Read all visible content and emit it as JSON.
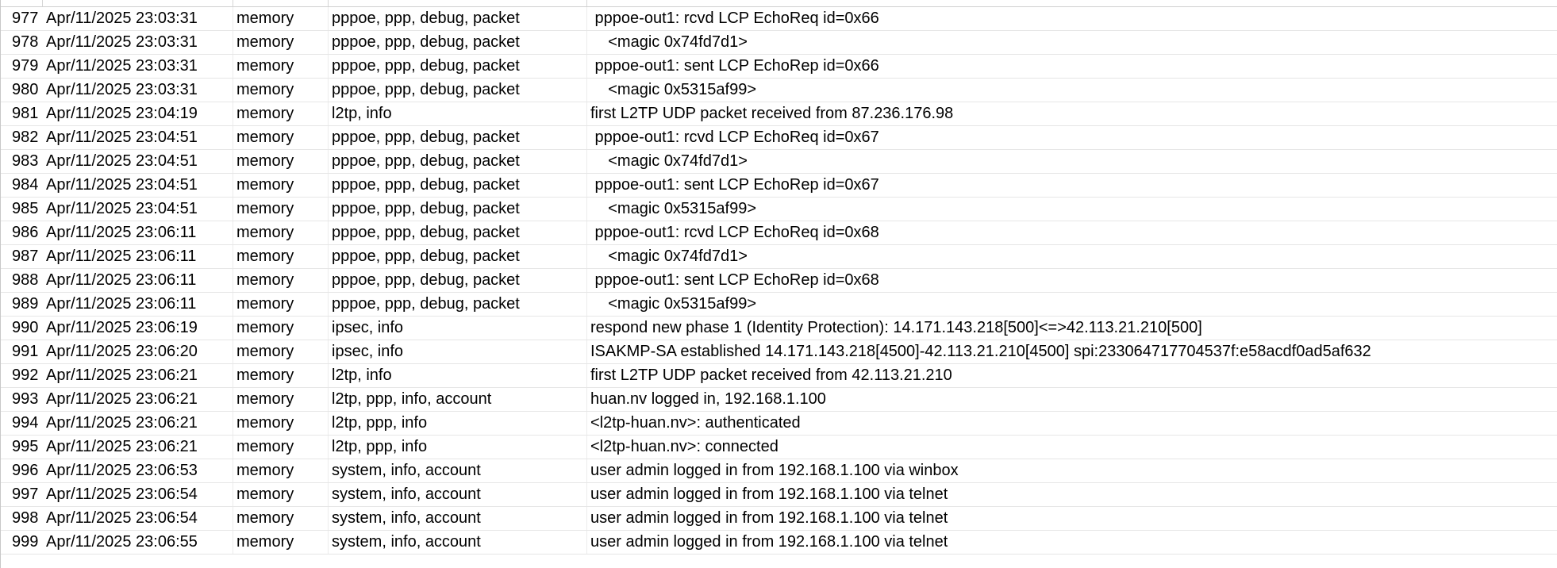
{
  "log_rows": [
    {
      "id": "977",
      "time": "Apr/11/2025 23:03:31",
      "buffer": "memory",
      "topics": "pppoe, ppp, debug, packet",
      "message": " pppoe-out1: rcvd LCP EchoReq id=0x66"
    },
    {
      "id": "978",
      "time": "Apr/11/2025 23:03:31",
      "buffer": "memory",
      "topics": "pppoe, ppp, debug, packet",
      "message": "    <magic 0x74fd7d1>"
    },
    {
      "id": "979",
      "time": "Apr/11/2025 23:03:31",
      "buffer": "memory",
      "topics": "pppoe, ppp, debug, packet",
      "message": " pppoe-out1: sent LCP EchoRep id=0x66"
    },
    {
      "id": "980",
      "time": "Apr/11/2025 23:03:31",
      "buffer": "memory",
      "topics": "pppoe, ppp, debug, packet",
      "message": "    <magic 0x5315af99>"
    },
    {
      "id": "981",
      "time": "Apr/11/2025 23:04:19",
      "buffer": "memory",
      "topics": "l2tp, info",
      "message": "first L2TP UDP packet received from 87.236.176.98"
    },
    {
      "id": "982",
      "time": "Apr/11/2025 23:04:51",
      "buffer": "memory",
      "topics": "pppoe, ppp, debug, packet",
      "message": " pppoe-out1: rcvd LCP EchoReq id=0x67"
    },
    {
      "id": "983",
      "time": "Apr/11/2025 23:04:51",
      "buffer": "memory",
      "topics": "pppoe, ppp, debug, packet",
      "message": "    <magic 0x74fd7d1>"
    },
    {
      "id": "984",
      "time": "Apr/11/2025 23:04:51",
      "buffer": "memory",
      "topics": "pppoe, ppp, debug, packet",
      "message": " pppoe-out1: sent LCP EchoRep id=0x67"
    },
    {
      "id": "985",
      "time": "Apr/11/2025 23:04:51",
      "buffer": "memory",
      "topics": "pppoe, ppp, debug, packet",
      "message": "    <magic 0x5315af99>"
    },
    {
      "id": "986",
      "time": "Apr/11/2025 23:06:11",
      "buffer": "memory",
      "topics": "pppoe, ppp, debug, packet",
      "message": " pppoe-out1: rcvd LCP EchoReq id=0x68"
    },
    {
      "id": "987",
      "time": "Apr/11/2025 23:06:11",
      "buffer": "memory",
      "topics": "pppoe, ppp, debug, packet",
      "message": "    <magic 0x74fd7d1>"
    },
    {
      "id": "988",
      "time": "Apr/11/2025 23:06:11",
      "buffer": "memory",
      "topics": "pppoe, ppp, debug, packet",
      "message": " pppoe-out1: sent LCP EchoRep id=0x68"
    },
    {
      "id": "989",
      "time": "Apr/11/2025 23:06:11",
      "buffer": "memory",
      "topics": "pppoe, ppp, debug, packet",
      "message": "    <magic 0x5315af99>"
    },
    {
      "id": "990",
      "time": "Apr/11/2025 23:06:19",
      "buffer": "memory",
      "topics": "ipsec, info",
      "message": "respond new phase 1 (Identity Protection): 14.171.143.218[500]<=>42.113.21.210[500]"
    },
    {
      "id": "991",
      "time": "Apr/11/2025 23:06:20",
      "buffer": "memory",
      "topics": "ipsec, info",
      "message": "ISAKMP-SA established 14.171.143.218[4500]-42.113.21.210[4500] spi:233064717704537f:e58acdf0ad5af632"
    },
    {
      "id": "992",
      "time": "Apr/11/2025 23:06:21",
      "buffer": "memory",
      "topics": "l2tp, info",
      "message": "first L2TP UDP packet received from 42.113.21.210"
    },
    {
      "id": "993",
      "time": "Apr/11/2025 23:06:21",
      "buffer": "memory",
      "topics": "l2tp, ppp, info, account",
      "message": "huan.nv logged in, 192.168.1.100"
    },
    {
      "id": "994",
      "time": "Apr/11/2025 23:06:21",
      "buffer": "memory",
      "topics": "l2tp, ppp, info",
      "message": "<l2tp-huan.nv>: authenticated"
    },
    {
      "id": "995",
      "time": "Apr/11/2025 23:06:21",
      "buffer": "memory",
      "topics": "l2tp, ppp, info",
      "message": "<l2tp-huan.nv>: connected"
    },
    {
      "id": "996",
      "time": "Apr/11/2025 23:06:53",
      "buffer": "memory",
      "topics": "system, info, account",
      "message": "user admin logged in from 192.168.1.100 via winbox"
    },
    {
      "id": "997",
      "time": "Apr/11/2025 23:06:54",
      "buffer": "memory",
      "topics": "system, info, account",
      "message": "user admin logged in from 192.168.1.100 via telnet"
    },
    {
      "id": "998",
      "time": "Apr/11/2025 23:06:54",
      "buffer": "memory",
      "topics": "system, info, account",
      "message": "user admin logged in from 192.168.1.100 via telnet"
    },
    {
      "id": "999",
      "time": "Apr/11/2025 23:06:55",
      "buffer": "memory",
      "topics": "system, info, account",
      "message": "user admin logged in from 192.168.1.100 via telnet"
    }
  ]
}
